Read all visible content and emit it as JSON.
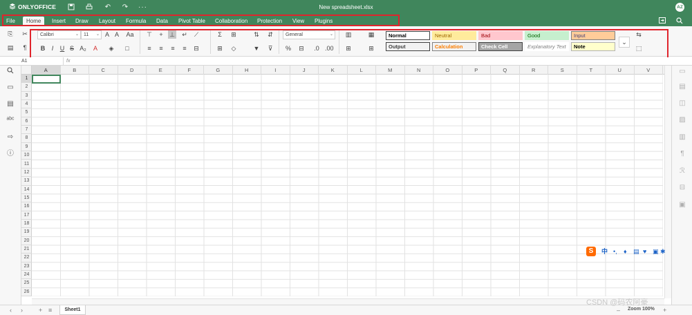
{
  "titlebar": {
    "app_name": "ONLYOFFICE",
    "document_title": "New spreadsheet.xlsx",
    "user_initials": "AZ",
    "brand_color": "#40865c"
  },
  "menu": {
    "tabs": [
      "File",
      "Home",
      "Insert",
      "Draw",
      "Layout",
      "Formula",
      "Data",
      "Pivot Table",
      "Collaboration",
      "Protection",
      "View",
      "Plugins"
    ],
    "active_tab": "Home"
  },
  "toolbar": {
    "font_name": "Calibri",
    "font_size": "11",
    "number_format": "General",
    "styles": [
      {
        "label": "Normal",
        "bg": "#ffffff",
        "fg": "#000000",
        "border": "#444444"
      },
      {
        "label": "Neutral",
        "bg": "#ffeb9c",
        "fg": "#9c6500",
        "border": "#ffeb9c"
      },
      {
        "label": "Bad",
        "bg": "#ffc7ce",
        "fg": "#9c0006",
        "border": "#ffc7ce"
      },
      {
        "label": "Good",
        "bg": "#c6efce",
        "fg": "#006100",
        "border": "#c6efce"
      },
      {
        "label": "Input",
        "bg": "#ffcc99",
        "fg": "#3f3f76",
        "border": "#7f7f7f"
      },
      {
        "label": "Output",
        "bg": "#f2f2f2",
        "fg": "#3f3f3f",
        "border": "#3f3f3f"
      },
      {
        "label": "Calculation",
        "bg": "#f2f2f2",
        "fg": "#fa7d00",
        "border": "#7f7f7f"
      },
      {
        "label": "Check Cell",
        "bg": "#a5a5a5",
        "fg": "#ffffff",
        "border": "#3f3f3f"
      },
      {
        "label": "Explanatory Text",
        "bg": "#ffffff",
        "fg": "#7f7f7f",
        "border": "#ffffff"
      },
      {
        "label": "Note",
        "bg": "#ffffcc",
        "fg": "#000000",
        "border": "#b2b2b2"
      }
    ]
  },
  "formula_bar": {
    "name_box": "A1",
    "fx_label": "fx",
    "value": ""
  },
  "grid": {
    "columns": [
      "A",
      "B",
      "C",
      "D",
      "E",
      "F",
      "G",
      "H",
      "I",
      "J",
      "K",
      "L",
      "M",
      "N",
      "O",
      "P",
      "Q",
      "R",
      "S",
      "T",
      "U",
      "V"
    ],
    "rows": [
      "1",
      "2",
      "3",
      "4",
      "5",
      "6",
      "7",
      "8",
      "9",
      "10",
      "11",
      "12",
      "13",
      "14",
      "15",
      "16",
      "17",
      "18",
      "19",
      "20",
      "21",
      "22",
      "23",
      "24",
      "25",
      "26"
    ],
    "selected_cell": "A1"
  },
  "status_bar": {
    "sheet_name": "Sheet1",
    "zoom_label": "Zoom 100%"
  },
  "overlay": {
    "watermark": "CSDN @码农阿豪",
    "ime_label": "中"
  }
}
